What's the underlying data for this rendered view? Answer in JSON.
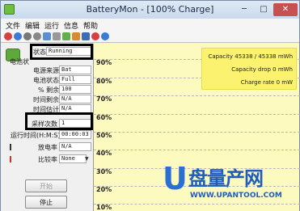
{
  "window": {
    "title": "BatteryMon - [100% Charge]"
  },
  "menu": [
    "文件",
    "编辑",
    "运行",
    "信息",
    "帮助"
  ],
  "toolbar_icons": [
    "stop-icon",
    "info-icon",
    "settings-icon",
    "clock-icon",
    "save-icon",
    "report-icon",
    "battery-icon",
    "chart-icon",
    "graph-icon",
    "close-icon",
    "help-icon"
  ],
  "panel": {
    "status_label": "状态",
    "status_value": "Running",
    "battery_label": "电池状",
    "power_source_label": "电源来源",
    "power_source_value": "Bat",
    "battery_status_label": "电池状态",
    "battery_status_value": "Full",
    "percent_label": "% 剩余",
    "percent_value": "100",
    "time_remaining_label": "时间剩余",
    "time_remaining_value": "N/A",
    "time_elapsed_label": "时间估计",
    "time_elapsed_value": "N/A",
    "samples_label": "采样次数",
    "samples_value": "1",
    "runtime_label": "运行时间(H:M:S)",
    "runtime_value": "00:00:03",
    "discharge_label": "放电率",
    "discharge_value": "N/A",
    "compare_label": "比较率",
    "compare_value": "None",
    "start_button": "开始",
    "stop_button": "停止"
  },
  "chart_data": {
    "type": "line",
    "ticks": [
      "90%",
      "80%",
      "70%",
      "60%",
      "50%",
      "40%",
      "30%",
      "20%",
      "10%"
    ],
    "info": [
      "Capacity 45338 / 45338 mWh",
      "Capacity drop 0 mWh",
      "Charge rate 0 mW"
    ],
    "background": "#fdfac0"
  },
  "watermark": {
    "text": "盘量产网",
    "url": "WWW.UPANTOOL.COM"
  }
}
